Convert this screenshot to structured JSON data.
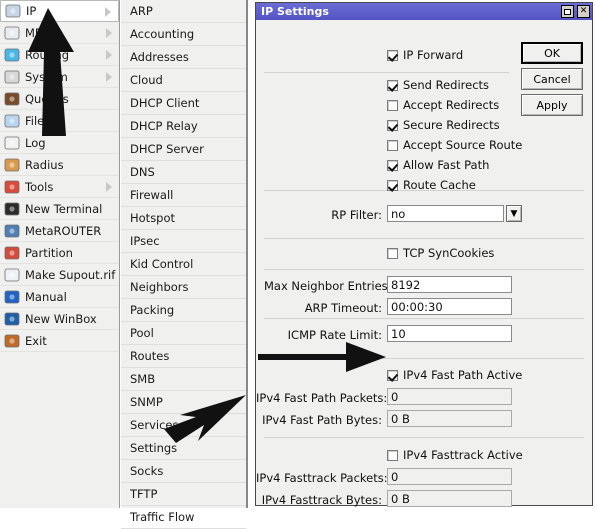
{
  "sidebar": {
    "items": [
      {
        "label": "IP",
        "icon": "ip-255-icon",
        "chevron": true,
        "selected": true
      },
      {
        "label": "MPLS",
        "icon": "mpls-labels-icon",
        "chevron": true,
        "selected": false
      },
      {
        "label": "Routing",
        "icon": "routing-icon",
        "chevron": true,
        "selected": false
      },
      {
        "label": "System",
        "icon": "system-gear-icon",
        "chevron": true,
        "selected": false
      },
      {
        "label": "Queues",
        "icon": "queues-icon",
        "chevron": false,
        "selected": false
      },
      {
        "label": "Files",
        "icon": "folder-icon",
        "chevron": false,
        "selected": false
      },
      {
        "label": "Log",
        "icon": "log-icon",
        "chevron": false,
        "selected": false
      },
      {
        "label": "Radius",
        "icon": "radius-users-icon",
        "chevron": false,
        "selected": false
      },
      {
        "label": "Tools",
        "icon": "tools-wrench-icon",
        "chevron": true,
        "selected": false
      },
      {
        "label": "New Terminal",
        "icon": "terminal-icon",
        "chevron": false,
        "selected": false
      },
      {
        "label": "MetaROUTER",
        "icon": "metarouter-icon",
        "chevron": false,
        "selected": false
      },
      {
        "label": "Partition",
        "icon": "partition-piechart-icon",
        "chevron": false,
        "selected": false
      },
      {
        "label": "Make Supout.rif",
        "icon": "document-export-icon",
        "chevron": false,
        "selected": false
      },
      {
        "label": "Manual",
        "icon": "help-question-icon",
        "chevron": false,
        "selected": false
      },
      {
        "label": "New WinBox",
        "icon": "winbox-icon",
        "chevron": false,
        "selected": false
      },
      {
        "label": "Exit",
        "icon": "exit-door-icon",
        "chevron": false,
        "selected": false
      }
    ]
  },
  "submenu": {
    "items": [
      {
        "label": "ARP"
      },
      {
        "label": "Accounting"
      },
      {
        "label": "Addresses"
      },
      {
        "label": "Cloud"
      },
      {
        "label": "DHCP Client"
      },
      {
        "label": "DHCP Relay"
      },
      {
        "label": "DHCP Server"
      },
      {
        "label": "DNS"
      },
      {
        "label": "Firewall"
      },
      {
        "label": "Hotspot"
      },
      {
        "label": "IPsec"
      },
      {
        "label": "Kid Control"
      },
      {
        "label": "Neighbors"
      },
      {
        "label": "Packing"
      },
      {
        "label": "Pool"
      },
      {
        "label": "Routes"
      },
      {
        "label": "SMB"
      },
      {
        "label": "SNMP"
      },
      {
        "label": "Services"
      },
      {
        "label": "Settings"
      },
      {
        "label": "Socks"
      },
      {
        "label": "TFTP"
      },
      {
        "label": "Traffic Flow"
      }
    ]
  },
  "dialog": {
    "title": "IP Settings",
    "titlebar_buttons": {
      "maximize": "maximize-icon",
      "close": "close-icon"
    },
    "buttons": {
      "ok": "OK",
      "cancel": "Cancel",
      "apply": "Apply"
    },
    "checkboxes": [
      {
        "label": "IP Forward",
        "checked": true
      },
      {
        "label": "Send Redirects",
        "checked": true
      },
      {
        "label": "Accept Redirects",
        "checked": false
      },
      {
        "label": "Secure Redirects",
        "checked": true
      },
      {
        "label": "Accept Source Route",
        "checked": false
      },
      {
        "label": "Allow Fast Path",
        "checked": true
      },
      {
        "label": "Route Cache",
        "checked": true
      },
      {
        "label": "TCP SynCookies",
        "checked": false
      },
      {
        "label": "IPv4 Fast Path Active",
        "checked": true
      },
      {
        "label": "IPv4 Fasttrack Active",
        "checked": false
      }
    ],
    "rp_filter": {
      "label": "RP Filter:",
      "value": "no",
      "dropdown_icon": "chevron-down-icon"
    },
    "fields": [
      {
        "label": "Max Neighbor Entries:",
        "value": "8192",
        "readonly": false
      },
      {
        "label": "ARP Timeout:",
        "value": "00:00:30",
        "readonly": false
      },
      {
        "label": "ICMP Rate Limit:",
        "value": "10",
        "readonly": false
      },
      {
        "label": "IPv4 Fast Path Packets:",
        "value": "0",
        "readonly": true
      },
      {
        "label": "IPv4 Fast Path Bytes:",
        "value": "0 B",
        "readonly": true
      },
      {
        "label": "IPv4 Fasttrack Packets:",
        "value": "0",
        "readonly": true
      },
      {
        "label": "IPv4 Fasttrack Bytes:",
        "value": "0 B",
        "readonly": true
      }
    ]
  },
  "annotations": {
    "arrow_sidebar": "arrow-pointing-to-ip",
    "arrow_settings": "arrow-pointing-to-settings",
    "arrow_fastpath": "arrow-pointing-to-ipv4-fast-path-active"
  },
  "colors": {
    "titlebar": "#5353c4",
    "window_bg": "#f0f0ef",
    "field_bg": "#ffffff",
    "border": "#8a8a8a"
  }
}
